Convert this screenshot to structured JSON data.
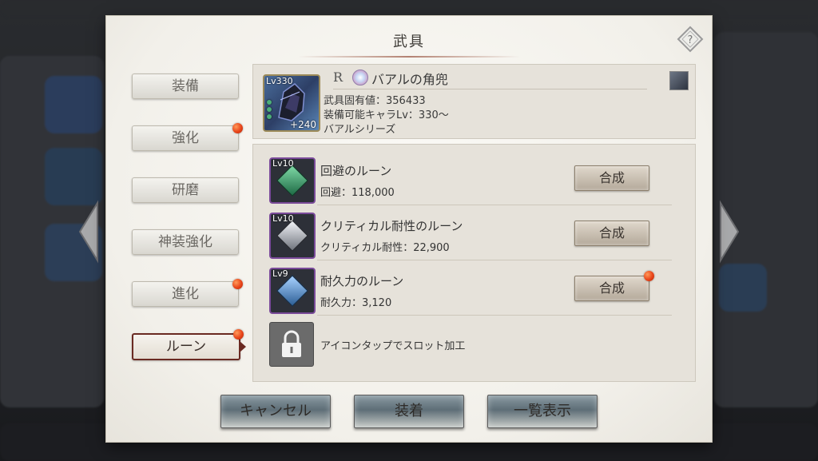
{
  "dialog": {
    "title": "武具",
    "help_icon": "help-diamond-icon"
  },
  "tabs": [
    {
      "label": "装備",
      "active": false,
      "badge": false
    },
    {
      "label": "強化",
      "active": false,
      "badge": true
    },
    {
      "label": "研磨",
      "active": false,
      "badge": false
    },
    {
      "label": "神装強化",
      "active": false,
      "badge": false
    },
    {
      "label": "進化",
      "active": false,
      "badge": true
    },
    {
      "label": "ルーン",
      "active": true,
      "badge": true
    }
  ],
  "weapon": {
    "level": "Lv330",
    "plus": "+240",
    "rarity": "R",
    "name": "バアルの角兜",
    "stat_line": "武具固有値：356433",
    "level_req_line": "装備可能キャラLv：330～",
    "series": "バアルシリーズ"
  },
  "runes": [
    {
      "level": "Lv10",
      "name": "回避のルーン",
      "stat": "回避：118,000",
      "button": "合成",
      "badge": false,
      "color": "#2e8a5c"
    },
    {
      "level": "Lv10",
      "name": "クリティカル耐性のルーン",
      "stat": "クリティカル耐性：22,900",
      "button": "合成",
      "badge": false,
      "color": "#c9ccd2"
    },
    {
      "level": "Lv9",
      "name": "耐久力のルーン",
      "stat": "耐久力：3,120",
      "button": "合成",
      "badge": true,
      "color": "#4c7fb0"
    }
  ],
  "locked_slot": {
    "text": "アイコンタップでスロット加工"
  },
  "buttons": {
    "cancel": "キャンセル",
    "equip": "装着",
    "list": "一覧表示"
  }
}
